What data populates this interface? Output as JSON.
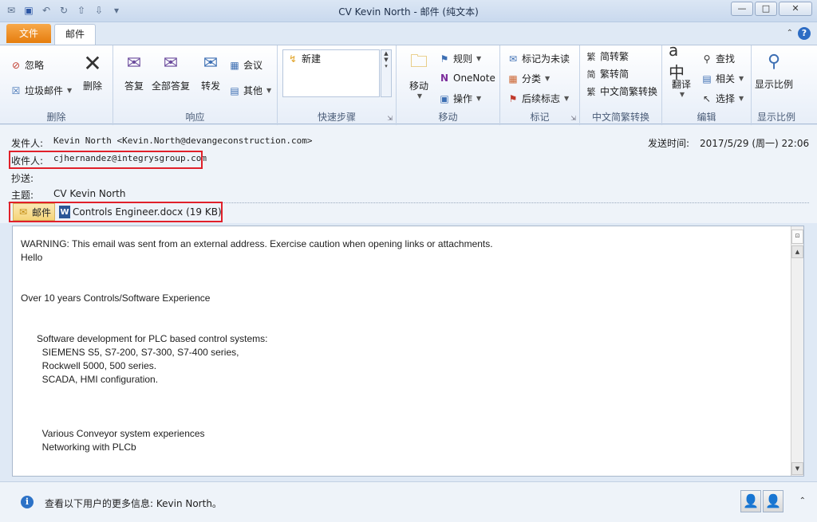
{
  "window": {
    "title": "CV Kevin North  - 邮件 (纯文本)",
    "min": "—",
    "max": "□",
    "close": "✕"
  },
  "tabs": {
    "file": "文件",
    "mail": "邮件"
  },
  "ribbon": {
    "delete_group": {
      "label": "删除",
      "ignore": "忽略",
      "junk": "垃圾邮件",
      "delete": "删除"
    },
    "respond_group": {
      "label": "响应",
      "reply": "答复",
      "reply_all": "全部答复",
      "forward": "转发",
      "meeting": "会议",
      "more": "其他"
    },
    "quicksteps_group": {
      "label": "快速步骤",
      "new": "新建"
    },
    "move_group": {
      "label": "移动",
      "move": "移动",
      "rules": "规则",
      "onenote": "OneNote",
      "actions": "操作"
    },
    "tags_group": {
      "label": "标记",
      "mark_unread": "标记为未读",
      "categorize": "分类",
      "followup": "后续标志"
    },
    "chinese_group": {
      "label": "中文简繁转换",
      "to_trad": "简转繁",
      "to_simp": "繁转简",
      "convert": "中文简繁转换"
    },
    "edit_group": {
      "label": "编辑",
      "translate": "翻译",
      "find": "查找",
      "related": "相关",
      "select": "选择"
    },
    "zoom_group": {
      "label": "显示比例",
      "zoom": "显示比例"
    }
  },
  "header": {
    "from_label": "发件人:",
    "from_value": "Kevin North <Kevin.North@devangeconstruction.com>",
    "sent_label": "发送时间:",
    "sent_value": "2017/5/29 (周一) 22:06",
    "to_label": "收件人:",
    "to_value": "cjhernandez@integrysgroup.com",
    "cc_label": "抄送:",
    "subject_label": "主题:",
    "subject_value": "CV Kevin North",
    "attach_mail": "邮件",
    "attach_file": "Controls Engineer.docx (19 KB)"
  },
  "body": {
    "lines": [
      "WARNING: This email was sent from an external address. Exercise caution when opening links or attachments.",
      "Hello",
      "",
      "",
      "Over 10 years Controls/Software Experience",
      "",
      "",
      "      Software development for PLC based control systems:",
      "        SIEMENS S5, S7-200, S7-300, S7-400 series,",
      "        Rockwell 5000, 500 series.",
      "        SCADA, HMI configuration.",
      "",
      "",
      "",
      "        Various Conveyor system experiences",
      "        Networking with PLCb"
    ]
  },
  "footer": {
    "info_text": "查看以下用户的更多信息: Kevin North。"
  }
}
